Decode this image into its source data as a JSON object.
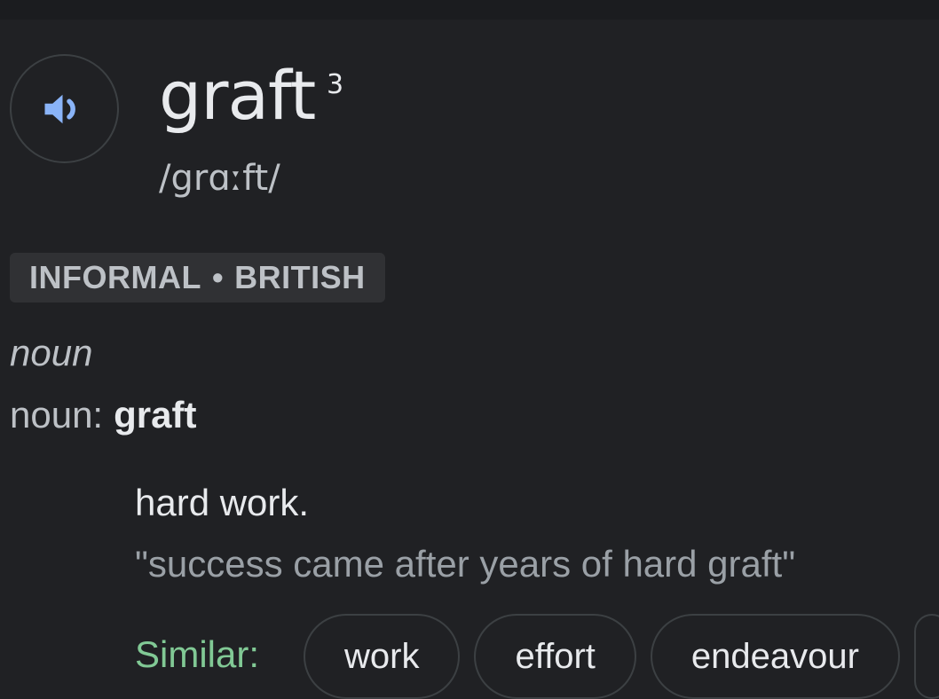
{
  "entry": {
    "headword": "graft",
    "superscript": "3",
    "phonetic": "/grɑːft/",
    "labels": [
      "INFORMAL",
      "BRITISH"
    ],
    "label_separator": "•",
    "part_of_speech": "noun",
    "pos_line_prefix": "noun:",
    "pos_line_form": "graft",
    "definition": "hard work.",
    "example": "\"success came after years of hard graft\""
  },
  "similar": {
    "label": "Similar:",
    "chips": [
      "work",
      "effort",
      "endeavour"
    ]
  },
  "colors": {
    "background": "#202124",
    "speaker_icon": "#8ab4f8",
    "similar_label": "#81c995"
  },
  "icons": {
    "speaker": "speaker-icon"
  }
}
